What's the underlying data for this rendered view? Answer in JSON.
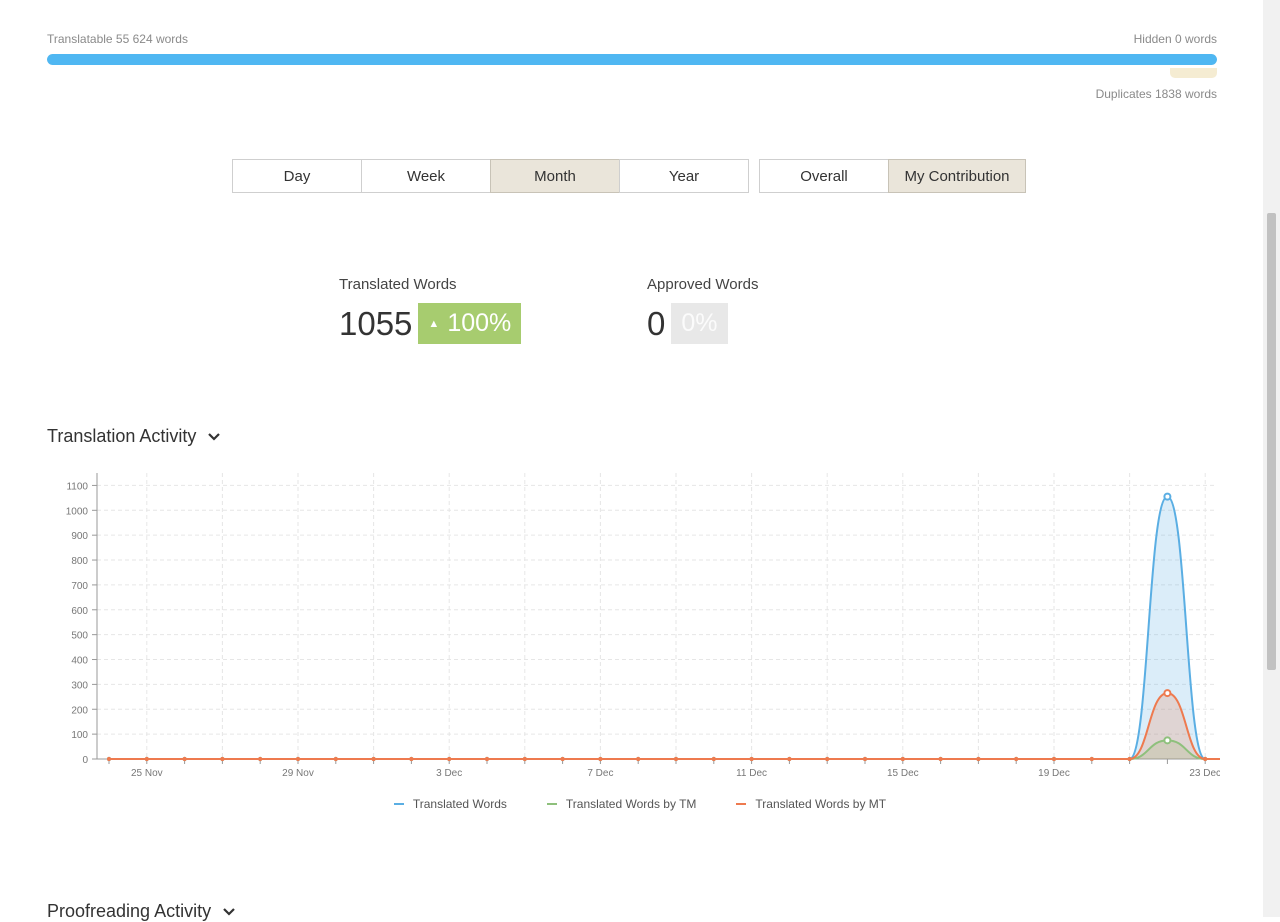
{
  "stats": {
    "translatable": "Translatable 55 624 words",
    "hidden": "Hidden 0 words",
    "duplicates": "Duplicates 1838 words",
    "progress_fill": 1.0
  },
  "period_buttons": [
    {
      "label": "Day",
      "active": false
    },
    {
      "label": "Week",
      "active": false
    },
    {
      "label": "Month",
      "active": true
    },
    {
      "label": "Year",
      "active": false
    }
  ],
  "scope_buttons": [
    {
      "label": "Overall",
      "active": false
    },
    {
      "label": "My Contribution",
      "active": true
    }
  ],
  "metrics": {
    "translated": {
      "title": "Translated Words",
      "value": "1055",
      "change": "100%"
    },
    "approved": {
      "title": "Approved Words",
      "value": "0",
      "change": "0%"
    }
  },
  "sections": {
    "translation_activity": "Translation Activity",
    "proofreading_activity": "Proofreading Activity"
  },
  "colors": {
    "translated": "#5aaee3",
    "tm": "#8ec07c",
    "mt": "#ee7a4f",
    "accent_blue": "#4fb7f2",
    "badge_green": "#a7cc6f"
  },
  "chart_data": {
    "type": "area",
    "x": [
      "24 Nov",
      "25 Nov",
      "26 Nov",
      "27 Nov",
      "28 Nov",
      "29 Nov",
      "30 Nov",
      "1 Dec",
      "2 Dec",
      "3 Dec",
      "4 Dec",
      "5 Dec",
      "6 Dec",
      "7 Dec",
      "8 Dec",
      "9 Dec",
      "10 Dec",
      "11 Dec",
      "12 Dec",
      "13 Dec",
      "14 Dec",
      "15 Dec",
      "16 Dec",
      "17 Dec",
      "18 Dec",
      "19 Dec",
      "20 Dec",
      "21 Dec",
      "22 Dec",
      "23 Dec",
      "24 Dec"
    ],
    "x_tick_labels": [
      "25 Nov",
      "29 Nov",
      "3 Dec",
      "7 Dec",
      "11 Dec",
      "15 Dec",
      "19 Dec",
      "23 Dec"
    ],
    "ylim": [
      0,
      1100
    ],
    "y_ticks": [
      0,
      100,
      200,
      300,
      400,
      500,
      600,
      700,
      800,
      900,
      1000,
      1100
    ],
    "grid": true,
    "legend_position": "bottom",
    "series": [
      {
        "name": "Translated Words",
        "values": [
          0,
          0,
          0,
          0,
          0,
          0,
          0,
          0,
          0,
          0,
          0,
          0,
          0,
          0,
          0,
          0,
          0,
          0,
          0,
          0,
          0,
          0,
          0,
          0,
          0,
          0,
          0,
          0,
          1055,
          0,
          0
        ]
      },
      {
        "name": "Translated Words by TM",
        "values": [
          0,
          0,
          0,
          0,
          0,
          0,
          0,
          0,
          0,
          0,
          0,
          0,
          0,
          0,
          0,
          0,
          0,
          0,
          0,
          0,
          0,
          0,
          0,
          0,
          0,
          0,
          0,
          0,
          75,
          0,
          0
        ]
      },
      {
        "name": "Translated Words by MT",
        "values": [
          0,
          0,
          0,
          0,
          0,
          0,
          0,
          0,
          0,
          0,
          0,
          0,
          0,
          0,
          0,
          0,
          0,
          0,
          0,
          0,
          0,
          0,
          0,
          0,
          0,
          0,
          0,
          0,
          265,
          0,
          0
        ]
      }
    ]
  }
}
